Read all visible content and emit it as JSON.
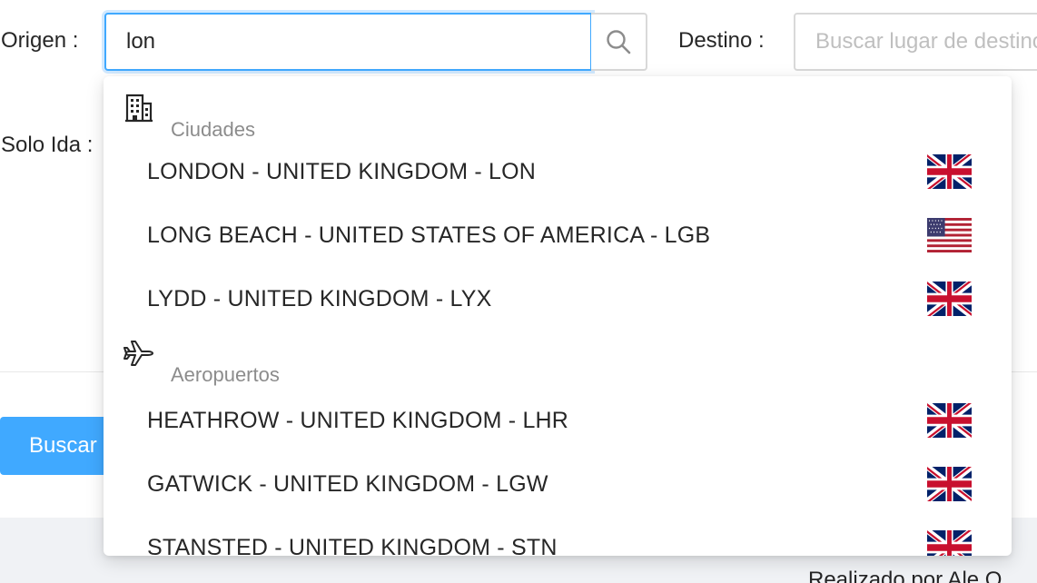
{
  "search": {
    "origin_label": "Origen",
    "origin_value": "lon",
    "destination_label": "Destino",
    "destination_placeholder": "Buscar lugar de destino",
    "one_way_label": "Solo Ida"
  },
  "buttons": {
    "search_label": "Buscar"
  },
  "footer": {
    "text": "Realizado por Ale O"
  },
  "dropdown": {
    "groups": [
      {
        "title": "Ciudades",
        "icon": "building-icon",
        "options": [
          {
            "label": "LONDON - UNITED KINGDOM - LON",
            "flag": "uk-flag-icon"
          },
          {
            "label": "LONG BEACH - UNITED STATES OF AMERICA - LGB",
            "flag": "us-flag-icon"
          },
          {
            "label": "LYDD - UNITED KINGDOM - LYX",
            "flag": "uk-flag-icon"
          }
        ]
      },
      {
        "title": "Aeropuertos",
        "icon": "plane-icon",
        "options": [
          {
            "label": "HEATHROW - UNITED KINGDOM - LHR",
            "flag": "uk-flag-icon"
          },
          {
            "label": "GATWICK - UNITED KINGDOM - LGW",
            "flag": "uk-flag-icon"
          },
          {
            "label": "STANSTED - UNITED KINGDOM - STN",
            "flag": "uk-flag-icon"
          }
        ]
      }
    ]
  },
  "colors": {
    "accent": "#40a9ff",
    "focus_border": "#40a9ff",
    "group_title": "#8c8c8c",
    "footer_bg": "#f0f2f5"
  }
}
